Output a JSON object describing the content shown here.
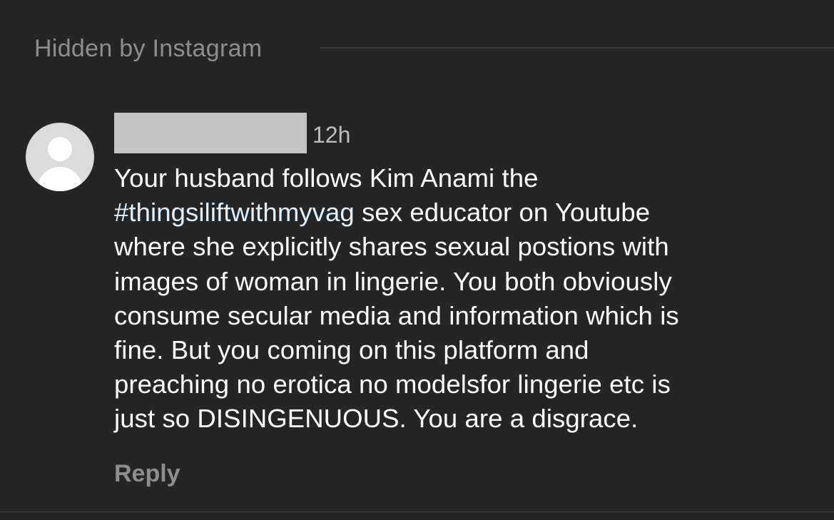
{
  "hidden_section": {
    "label": "Hidden by Instagram"
  },
  "comment": {
    "avatar_icon": "default-user-avatar-icon",
    "timestamp": "12h",
    "body_lines": [
      [
        "Your husband follows Kim Anami the"
      ],
      [
        "#thingsiliftwithmyvag",
        " sex educator on Youtube"
      ],
      [
        "where she explicitly shares sexual postions with"
      ],
      [
        "images of woman in lingerie. You both obviously"
      ],
      [
        "consume secular media and information which is"
      ],
      [
        "fine. But you coming on this platform and"
      ],
      [
        "preaching no erotica no modelsfor lingerie etc is"
      ],
      [
        "just so DISINGENUOUS. You are a disgrace."
      ]
    ],
    "reply_label": "Reply"
  },
  "colors": {
    "background": "#252525",
    "muted_text": "#8e8e8e",
    "hashtag": "#e0f1ff",
    "redaction": "#c4c4c4"
  }
}
